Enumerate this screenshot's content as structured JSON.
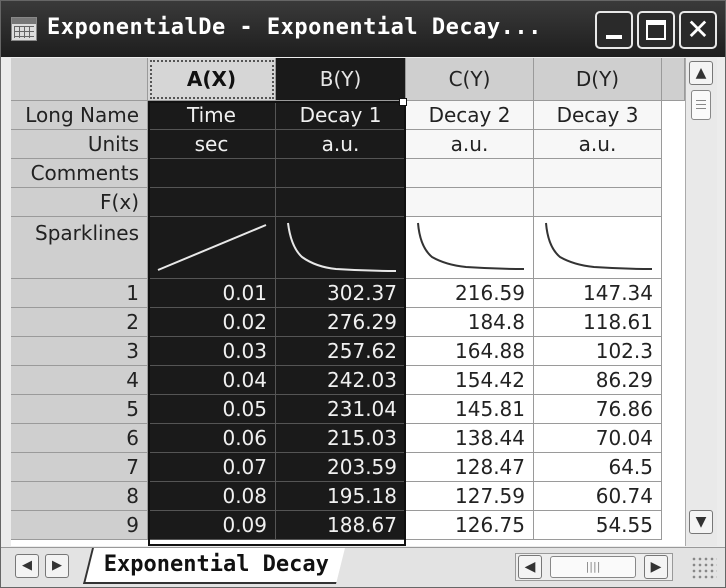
{
  "window": {
    "title": "ExponentialDe - Exponential Decay...",
    "close_glyph": "✕"
  },
  "columns": [
    {
      "header": "A(X)",
      "long_name": "Time",
      "units": "sec"
    },
    {
      "header": "B(Y)",
      "long_name": "Decay 1",
      "units": "a.u."
    },
    {
      "header": "C(Y)",
      "long_name": "Decay 2",
      "units": "a.u."
    },
    {
      "header": "D(Y)",
      "long_name": "Decay 3",
      "units": "a.u."
    }
  ],
  "row_labels": {
    "long_name": "Long Name",
    "units": "Units",
    "comments": "Comments",
    "fx": "F(x)",
    "sparklines": "Sparklines"
  },
  "rows": [
    {
      "n": "1",
      "a": "0.01",
      "b": "302.37",
      "c": "216.59",
      "d": "147.34"
    },
    {
      "n": "2",
      "a": "0.02",
      "b": "276.29",
      "c": "184.8",
      "d": "118.61"
    },
    {
      "n": "3",
      "a": "0.03",
      "b": "257.62",
      "c": "164.88",
      "d": "102.3"
    },
    {
      "n": "4",
      "a": "0.04",
      "b": "242.03",
      "c": "154.42",
      "d": "86.29"
    },
    {
      "n": "5",
      "a": "0.05",
      "b": "231.04",
      "c": "145.81",
      "d": "76.86"
    },
    {
      "n": "6",
      "a": "0.06",
      "b": "215.03",
      "c": "138.44",
      "d": "70.04"
    },
    {
      "n": "7",
      "a": "0.07",
      "b": "203.59",
      "c": "128.47",
      "d": "64.5"
    },
    {
      "n": "8",
      "a": "0.08",
      "b": "195.18",
      "c": "127.59",
      "d": "60.74"
    },
    {
      "n": "9",
      "a": "0.09",
      "b": "188.67",
      "c": "126.75",
      "d": "54.55"
    }
  ],
  "sheet_tab": {
    "label": "Exponential Decay"
  },
  "icons": {
    "scroll_up": "▲",
    "scroll_down": "▼",
    "scroll_left": "◀",
    "scroll_right": "▶",
    "grip": "||||"
  },
  "colors": {
    "selected_bg": "#1a1a1a",
    "header_bg": "#cfcfcf",
    "titlebar_bg": "#2a2a2a"
  }
}
